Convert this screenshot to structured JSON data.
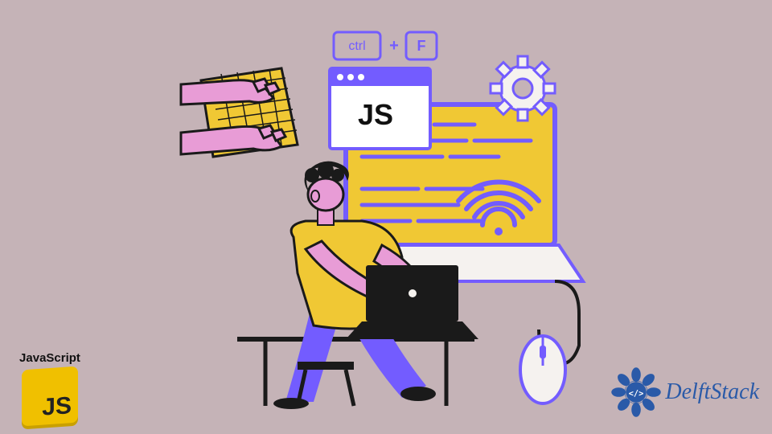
{
  "badge": {
    "title": "JavaScript",
    "logo_text": "JS"
  },
  "brand": {
    "name": "DelftStack"
  },
  "illustration": {
    "keycap_ctrl": "ctrl",
    "keycap_plus": "+",
    "keycap_f": "F",
    "window_title": "JS"
  },
  "colors": {
    "bg": "#c5b3b7",
    "purple": "#735cff",
    "yellow": "#f0c834",
    "pink": "#e89cd6",
    "dark": "#1a1a1a",
    "white": "#ffffff",
    "blue": "#2a5aa8"
  }
}
